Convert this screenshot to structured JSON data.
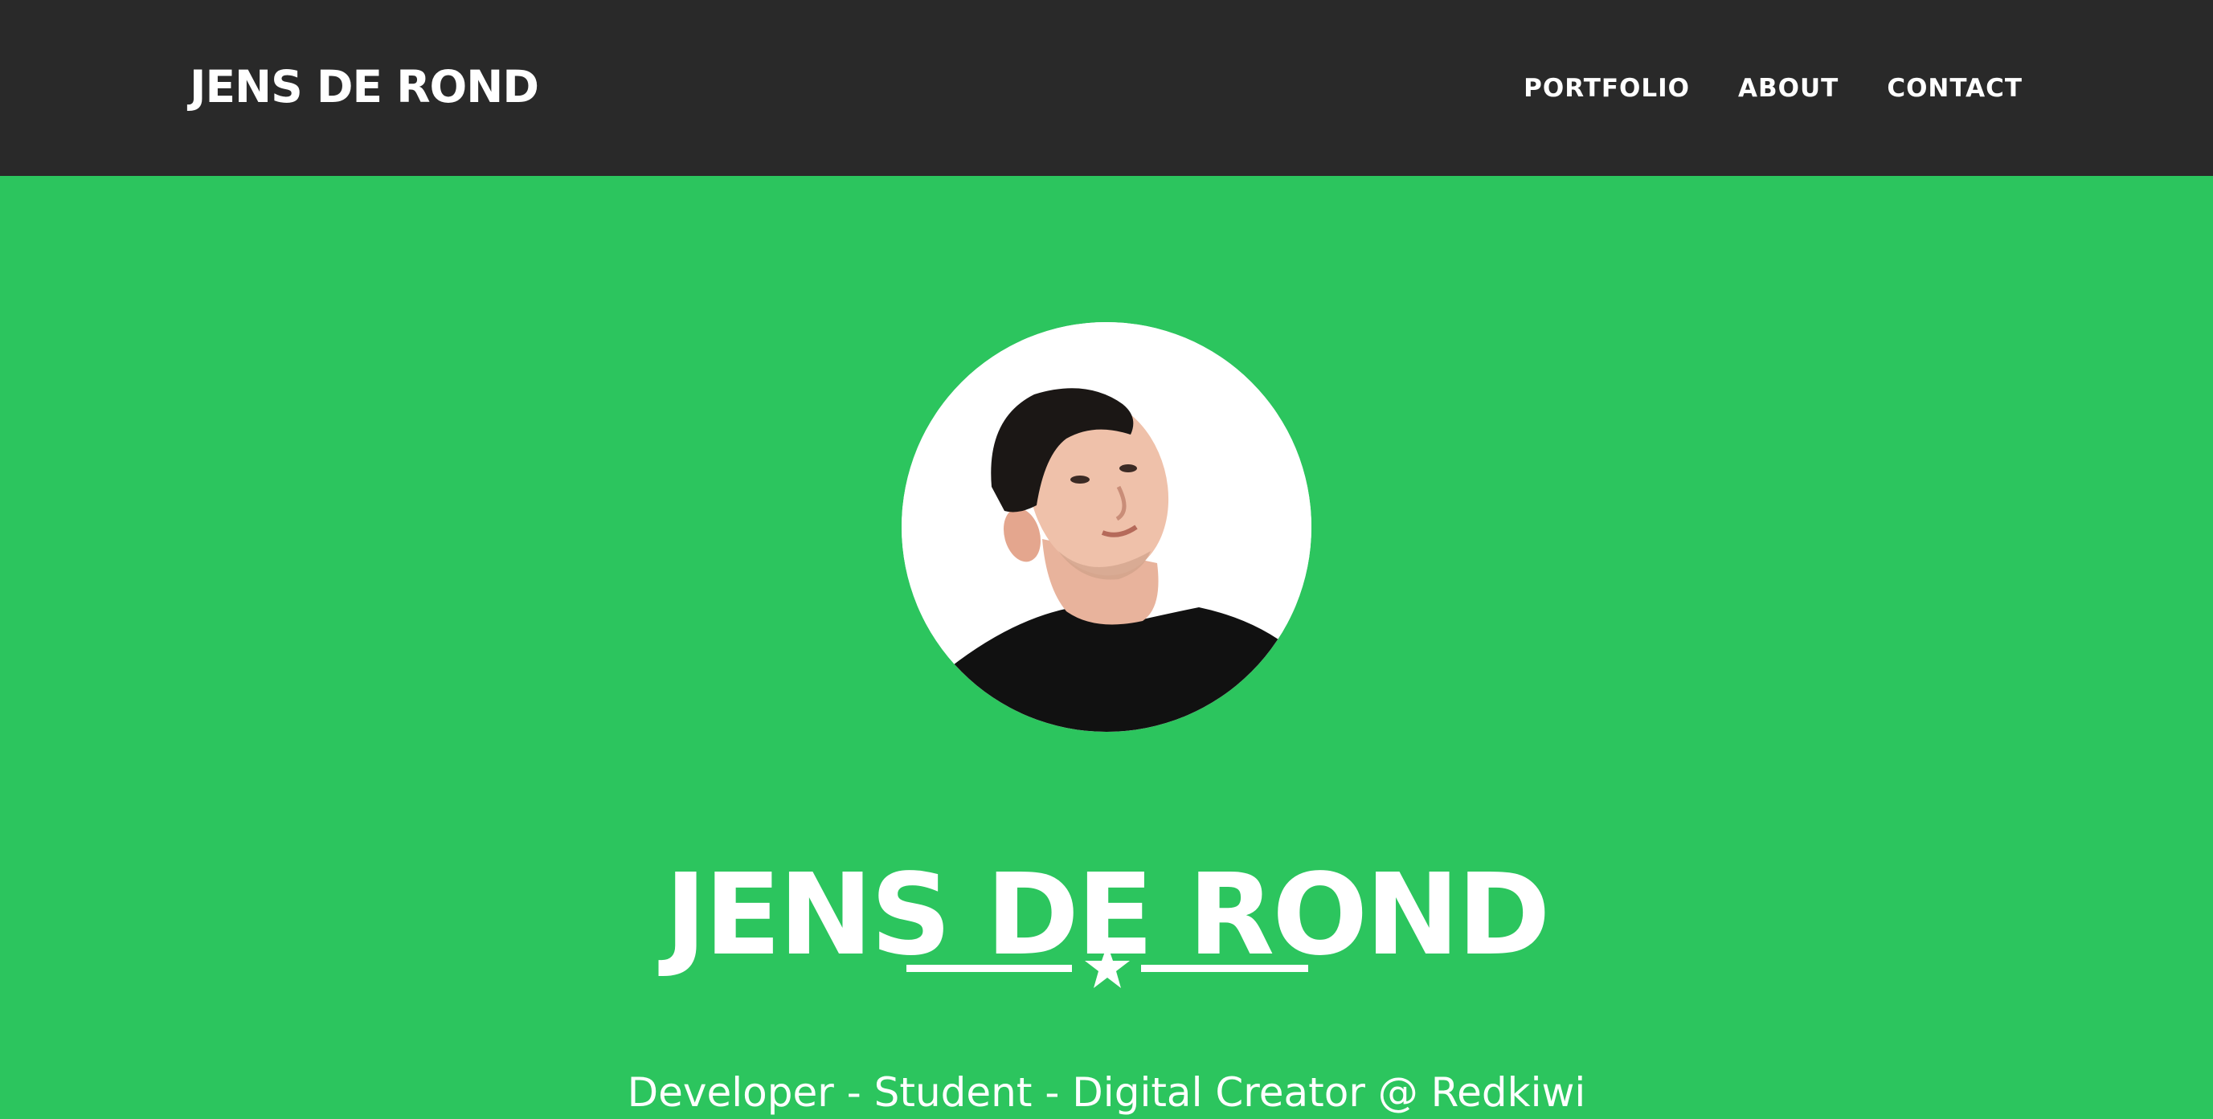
{
  "navbar": {
    "brand": "JENS DE ROND",
    "links": [
      {
        "label": "PORTFOLIO"
      },
      {
        "label": "ABOUT"
      },
      {
        "label": "CONTACT"
      }
    ]
  },
  "hero": {
    "avatar_alt": "profile-photo",
    "title": "JENS DE ROND",
    "divider_icon": "star-icon",
    "tagline": "Developer - Student - Digital Creator @ Redkiwi"
  },
  "colors": {
    "navbar_bg": "#292929",
    "hero_bg": "#2cc55e",
    "text": "#ffffff"
  }
}
